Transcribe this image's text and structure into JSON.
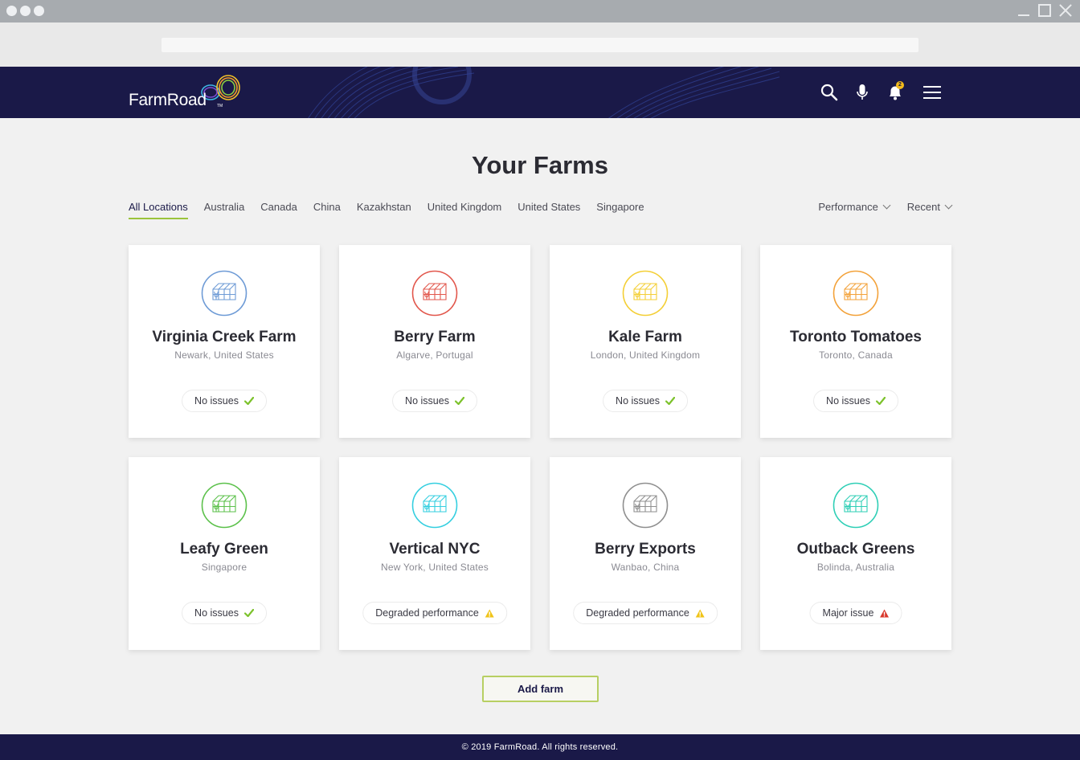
{
  "app": {
    "brand": "FarmRoad",
    "trademark": "TM",
    "notifications_count": "2"
  },
  "page": {
    "title": "Your Farms"
  },
  "filters": {
    "locations": [
      "All Locations",
      "Australia",
      "Canada",
      "China",
      "Kazakhstan",
      "United Kingdom",
      "United States",
      "Singapore"
    ],
    "active_location": "All Locations",
    "sort_performance": "Performance",
    "sort_recent": "Recent"
  },
  "farms": [
    {
      "name": "Virginia Creek Farm",
      "location": "Newark, United States",
      "status": "No issues",
      "status_type": "ok",
      "color": "#6e9bd6"
    },
    {
      "name": "Berry Farm",
      "location": "Algarve, Portugal",
      "status": "No issues",
      "status_type": "ok",
      "color": "#e2574c"
    },
    {
      "name": "Kale Farm",
      "location": "London, United Kingdom",
      "status": "No issues",
      "status_type": "ok",
      "color": "#f4cf36"
    },
    {
      "name": "Toronto Tomatoes",
      "location": "Toronto, Canada",
      "status": "No issues",
      "status_type": "ok",
      "color": "#f3a23a"
    },
    {
      "name": "Leafy Green",
      "location": "Singapore",
      "status": "No issues",
      "status_type": "ok",
      "color": "#5cc14b"
    },
    {
      "name": "Vertical NYC",
      "location": "New York, United States",
      "status": "Degraded performance",
      "status_type": "warning",
      "color": "#35cfe0"
    },
    {
      "name": "Berry Exports",
      "location": "Wanbao, China",
      "status": "Degraded performance",
      "status_type": "warning",
      "color": "#8f8f8f"
    },
    {
      "name": "Outback Greens",
      "location": "Bolinda, Australia",
      "status": "Major issue",
      "status_type": "error",
      "color": "#2fcfb6"
    }
  ],
  "status_colors": {
    "ok": "#7cc22b",
    "warning": "#f0c419",
    "error": "#d9372b"
  },
  "actions": {
    "add_farm": "Add farm"
  },
  "footer": {
    "copyright": "© 2019 FarmRoad. All rights reserved."
  }
}
